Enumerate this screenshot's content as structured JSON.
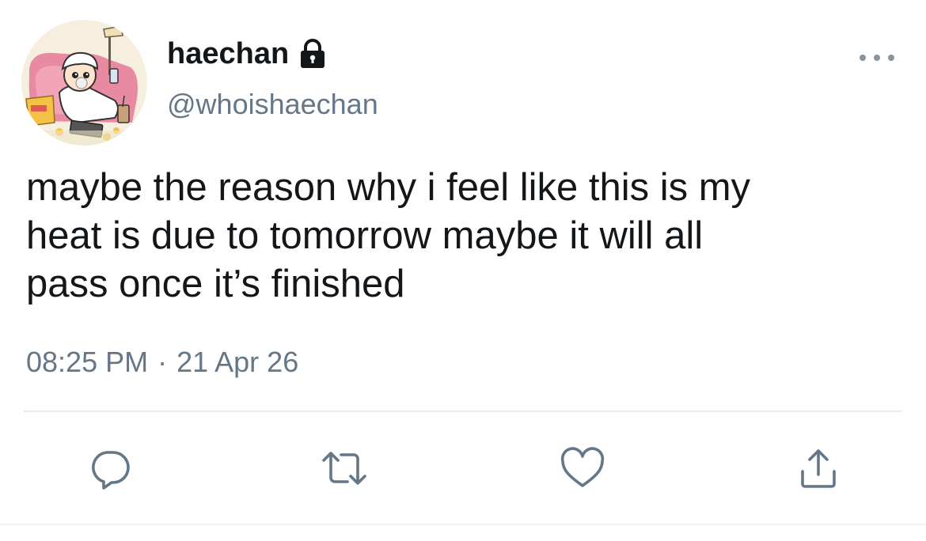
{
  "tweet": {
    "display_name": "haechan",
    "handle": "@whoishaechan",
    "protected_icon": "lock-icon",
    "text": "maybe the reason why i feel like this is my\nheat is due to tomorrow maybe it will all\npass once it’s finished",
    "time": "08:25 PM",
    "separator": "·",
    "date": "21 Apr 26"
  },
  "actions": [
    {
      "name": "reply",
      "icon": "reply-icon"
    },
    {
      "name": "retweet",
      "icon": "retweet-icon"
    },
    {
      "name": "like",
      "icon": "heart-icon"
    },
    {
      "name": "share",
      "icon": "share-icon"
    }
  ],
  "colors": {
    "text_primary": "#14171a",
    "text_secondary": "#657786",
    "icon": "#657786",
    "divider": "#e6ecf0"
  }
}
